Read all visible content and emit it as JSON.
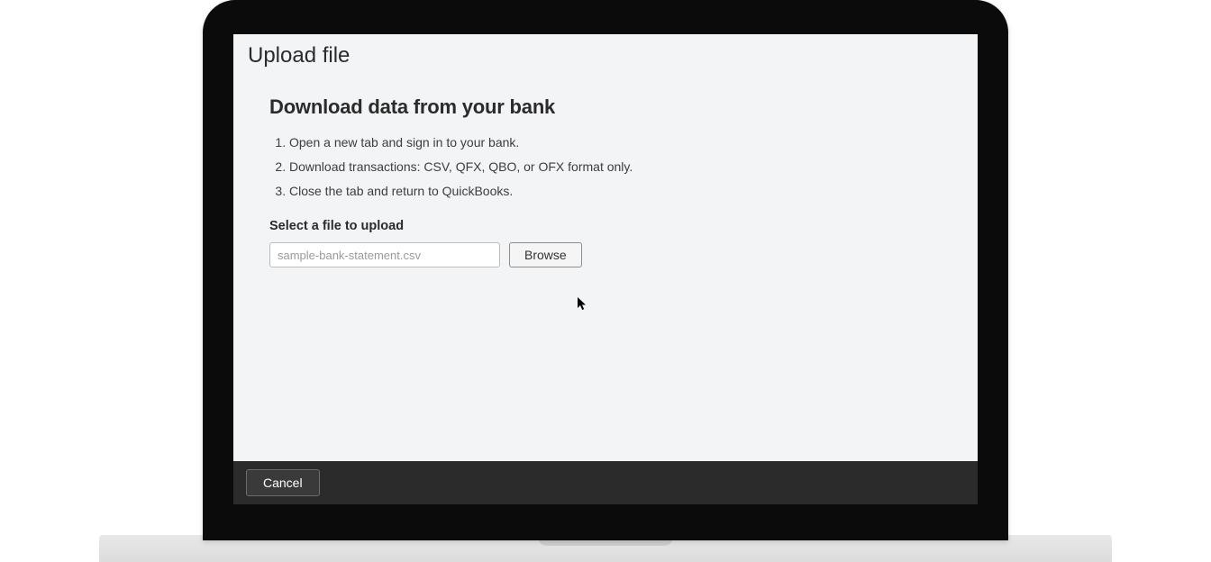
{
  "page": {
    "title": "Upload file"
  },
  "section": {
    "title": "Download data from your bank",
    "steps": [
      "Open a new tab and sign in to your bank.",
      "Download transactions: CSV, QFX, QBO, or OFX format only.",
      "Close the tab and return to QuickBooks."
    ]
  },
  "file": {
    "label": "Select a file to upload",
    "placeholder": "sample-bank-statement.csv",
    "browse_label": "Browse"
  },
  "footer": {
    "cancel_label": "Cancel"
  }
}
